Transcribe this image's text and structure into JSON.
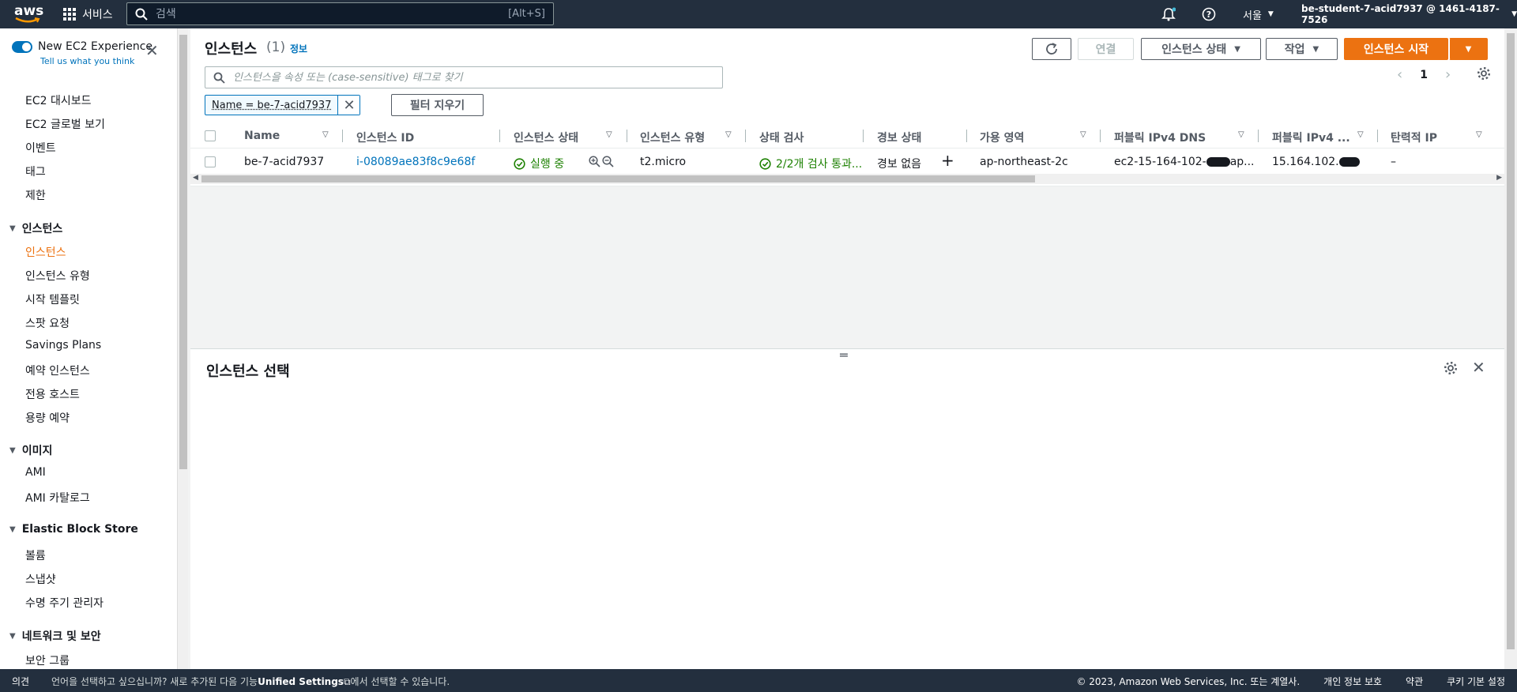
{
  "topnav": {
    "logo_text": "aws",
    "services_label": "서비스",
    "search_placeholder": "검색",
    "search_shortcut": "[Alt+S]",
    "region": "서울",
    "account": "be-student-7-acid7937 @ 1461-4187-7526"
  },
  "sidebar": {
    "new_experience_title": "New EC2 Experience",
    "new_experience_sub": "Tell us what you think",
    "top_items": [
      "EC2 대시보드",
      "EC2 글로벌 보기",
      "이벤트",
      "태그",
      "제한"
    ],
    "sections": [
      {
        "title": "인스턴스",
        "items": [
          "인스턴스",
          "인스턴스 유형",
          "시작 템플릿",
          "스팟 요청",
          "Savings Plans",
          "예약 인스턴스",
          "전용 호스트",
          "용량 예약"
        ]
      },
      {
        "title": "이미지",
        "items": [
          "AMI",
          "AMI 카탈로그"
        ]
      },
      {
        "title": "Elastic Block Store",
        "items": [
          "볼륨",
          "스냅샷",
          "수명 주기 관리자"
        ]
      },
      {
        "title": "네트워크 및 보안",
        "items": [
          "보안 그룹"
        ]
      }
    ]
  },
  "header": {
    "title": "인스턴스",
    "count": "(1)",
    "info": "정보",
    "connect_label": "연결",
    "state_label": "인스턴스 상태",
    "actions_label": "작업",
    "launch_label": "인스턴스 시작"
  },
  "filter": {
    "placeholder": "인스턴스을 속성 또는 (case-sensitive) 태그로 찾기",
    "token": "Name = be-7-acid7937",
    "clear_label": "필터 지우기",
    "page": "1"
  },
  "table": {
    "columns": [
      "Name",
      "인스턴스 ID",
      "인스턴스 상태",
      "인스턴스 유형",
      "상태 검사",
      "경보 상태",
      "가용 영역",
      "퍼블릭 IPv4 DNS",
      "퍼블릭 IPv4 ...",
      "탄력적 IP"
    ],
    "rows": [
      {
        "name": "be-7-acid7937",
        "id": "i-08089ae83f8c9e68f",
        "state": "실행 중",
        "type": "t2.micro",
        "check": "2/2개 검사 통과...",
        "alarm": "경보 없음",
        "az": "ap-northeast-2c",
        "dns": "ec2-15-164-102-",
        "dns_tail": "ap...",
        "ip": "15.164.102.",
        "eip": "–"
      }
    ]
  },
  "details": {
    "title": "인스턴스 선택"
  },
  "footer": {
    "feedback": "의견",
    "msg_pre": "언어을 선택하고 싶으십니까? 새로 추가된 다음 기능",
    "msg_bold": "Unified Settings",
    "msg_post": "에서 선택할 수 있습니다.",
    "copyright": "© 2023, Amazon Web Services, Inc. 또는 계열사.",
    "privacy": "개인 정보 보호",
    "terms": "약관",
    "cookies": "쿠키 기본 설정"
  },
  "colors": {
    "nav_bg": "#232f3e",
    "accent": "#ec7211",
    "link": "#0073bb",
    "success": "#1d8102"
  }
}
